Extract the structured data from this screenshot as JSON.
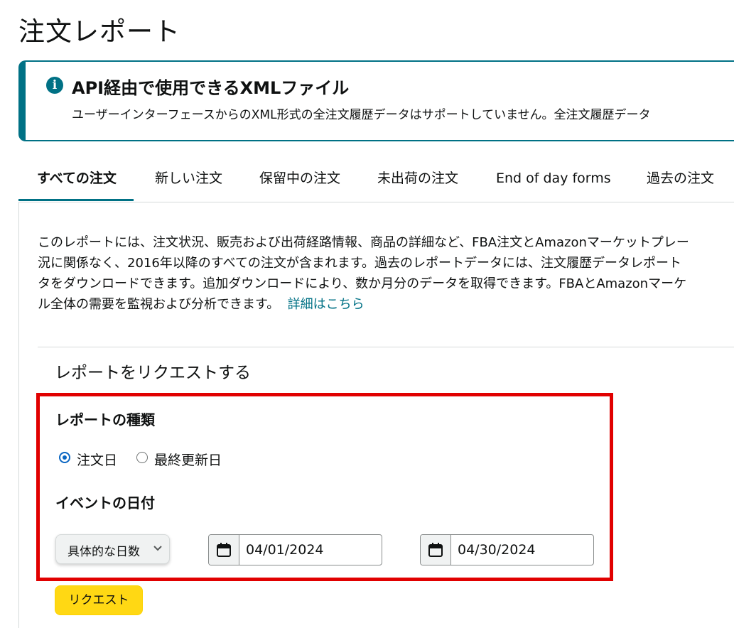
{
  "page_title": "注文レポート",
  "info": {
    "icon": "info-icon",
    "title": "API経由で使用できるXMLファイル",
    "text": "ユーザーインターフェースからのXML形式の全注文履歴データはサポートしていません。全注文履歴データ"
  },
  "tabs": [
    {
      "label": "すべての注文",
      "active": true
    },
    {
      "label": "新しい注文"
    },
    {
      "label": "保留中の注文"
    },
    {
      "label": "未出荷の注文"
    },
    {
      "label": "End of day forms"
    },
    {
      "label": "過去の注文"
    }
  ],
  "description": {
    "line1": "このレポートには、注文状況、販売および出荷経路情報、商品の詳細など、FBA注文とAmazonマーケットプレー",
    "line2": "況に関係なく、2016年以降のすべての注文が含まれます。過去のレポートデータには、注文履歴データレポート",
    "line3": "タをダウンロードできます。追加ダウンロードにより、数か月分のデータを取得できます。FBAとAmazonマーケ",
    "line4": "ル全体の需要を監視および分析できます。",
    "link": "詳細はこちら"
  },
  "request_section": {
    "heading": "レポートをリクエストする",
    "report_type_label": "レポートの種類",
    "radios": [
      {
        "label": "注文日",
        "checked": true
      },
      {
        "label": "最終更新日",
        "checked": false
      }
    ],
    "event_date_label": "イベントの日付",
    "range_select": "具体的な日数",
    "start_date": "04/01/2024",
    "end_date": "04/30/2024",
    "submit_label": "リクエスト"
  },
  "colors": {
    "accent": "#007185",
    "highlight_border": "#e10000",
    "button_yellow": "#ffd814",
    "radio_blue": "#0a66c2"
  }
}
